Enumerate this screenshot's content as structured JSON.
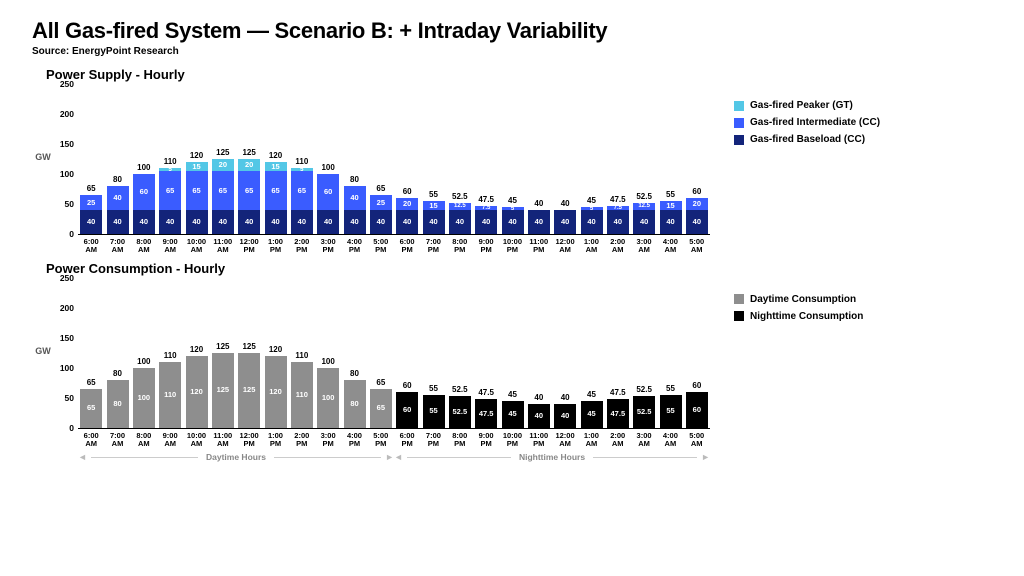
{
  "title": "All Gas-fired System — Scenario B: + Intraday Variability",
  "source": "Source: EnergyPoint Research",
  "yaxis_label": "GW",
  "yticks": [
    0,
    50,
    100,
    150,
    200,
    250
  ],
  "ymax": 250,
  "footer": {
    "day": "Daytime Hours",
    "night": "Nighttime Hours"
  },
  "colors": {
    "baseload": "#13247a",
    "intermediate": "#3a5cff",
    "peaker": "#53c7e6",
    "day_cons": "#8e8e8e",
    "night_cons": "#000000"
  },
  "chart_data": [
    {
      "name": "supply",
      "title": "Power Supply - Hourly",
      "type": "bar",
      "ylabel": "GW",
      "ylim": [
        0,
        250
      ],
      "legend": [
        {
          "key": "peaker",
          "label": "Gas-fired Peaker (GT)"
        },
        {
          "key": "intermediate",
          "label": "Gas-fired Intermediate (CC)"
        },
        {
          "key": "baseload",
          "label": "Gas-fired Baseload (CC)"
        }
      ],
      "categories": [
        "6:00 AM",
        "7:00 AM",
        "8:00 AM",
        "9:00 AM",
        "10:00 AM",
        "11:00 AM",
        "12:00 PM",
        "1:00 PM",
        "2:00 PM",
        "3:00 PM",
        "4:00 PM",
        "5:00 PM",
        "6:00 PM",
        "7:00 PM",
        "8:00 PM",
        "9:00 PM",
        "10:00 PM",
        "11:00 PM",
        "12:00 AM",
        "1:00 AM",
        "2:00 AM",
        "3:00 AM",
        "4:00 AM",
        "5:00 AM"
      ],
      "series": [
        {
          "name": "Gas-fired Baseload (CC)",
          "key": "baseload",
          "values": [
            40,
            40,
            40,
            40,
            40,
            40,
            40,
            40,
            40,
            40,
            40,
            40,
            40,
            40,
            40,
            40,
            40,
            40,
            40,
            40,
            40,
            40,
            40,
            40
          ]
        },
        {
          "name": "Gas-fired Intermediate (CC)",
          "key": "intermediate",
          "values": [
            25,
            40,
            60,
            65,
            65,
            65,
            65,
            65,
            65,
            60,
            40,
            25,
            20,
            15,
            12.5,
            7.5,
            5,
            0,
            0,
            5,
            7.5,
            12.5,
            15,
            20
          ]
        },
        {
          "name": "Gas-fired Peaker (GT)",
          "key": "peaker",
          "values": [
            0,
            0,
            0,
            5,
            15,
            20,
            20,
            15,
            5,
            0,
            0,
            0,
            0,
            0,
            0,
            0,
            0,
            0,
            0,
            0,
            0,
            0,
            0,
            0
          ]
        }
      ],
      "totals": [
        65,
        80,
        100,
        110,
        120,
        125,
        125,
        120,
        110,
        100,
        80,
        65,
        60,
        55,
        52.5,
        47.5,
        45,
        40,
        40,
        45,
        47.5,
        52.5,
        55,
        60
      ]
    },
    {
      "name": "consumption",
      "title": "Power Consumption - Hourly",
      "type": "bar",
      "ylabel": "GW",
      "ylim": [
        0,
        250
      ],
      "legend": [
        {
          "key": "day_cons",
          "label": "Daytime Consumption"
        },
        {
          "key": "night_cons",
          "label": "Nighttime Consumption"
        }
      ],
      "categories": [
        "6:00 AM",
        "7:00 AM",
        "8:00 AM",
        "9:00 AM",
        "10:00 AM",
        "11:00 AM",
        "12:00 PM",
        "1:00 PM",
        "2:00 PM",
        "3:00 PM",
        "4:00 PM",
        "5:00 PM",
        "6:00 PM",
        "7:00 PM",
        "8:00 PM",
        "9:00 PM",
        "10:00 PM",
        "11:00 PM",
        "12:00 AM",
        "1:00 AM",
        "2:00 AM",
        "3:00 AM",
        "4:00 AM",
        "5:00 AM"
      ],
      "series": [
        {
          "name": "Daytime Consumption",
          "key": "day_cons",
          "values": [
            65,
            80,
            100,
            110,
            120,
            125,
            125,
            120,
            110,
            100,
            80,
            65,
            0,
            0,
            0,
            0,
            0,
            0,
            0,
            0,
            0,
            0,
            0,
            0
          ]
        },
        {
          "name": "Nighttime Consumption",
          "key": "night_cons",
          "values": [
            0,
            0,
            0,
            0,
            0,
            0,
            0,
            0,
            0,
            0,
            0,
            0,
            60,
            55,
            52.5,
            47.5,
            45,
            40,
            40,
            45,
            47.5,
            52.5,
            55,
            60
          ]
        }
      ],
      "totals": [
        65,
        80,
        100,
        110,
        120,
        125,
        125,
        120,
        110,
        100,
        80,
        65,
        60,
        55,
        52.5,
        47.5,
        45,
        40,
        40,
        45,
        47.5,
        52.5,
        55,
        60
      ]
    }
  ]
}
